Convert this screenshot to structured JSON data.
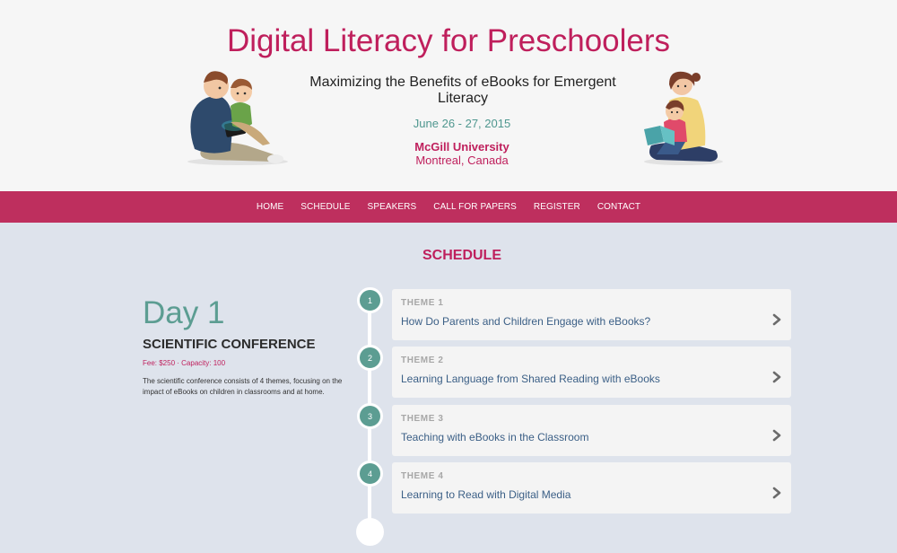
{
  "header": {
    "title": "Digital Literacy for Preschoolers",
    "subtitle": "Maximizing the Benefits of eBooks for Emergent Literacy",
    "dates": "June 26 - 27, 2015",
    "venue_name": "McGill University",
    "venue_location": "Montreal, Canada"
  },
  "nav": {
    "items": [
      {
        "label": "HOME"
      },
      {
        "label": "SCHEDULE"
      },
      {
        "label": "SPEAKERS"
      },
      {
        "label": "CALL FOR PAPERS"
      },
      {
        "label": "REGISTER"
      },
      {
        "label": "CONTACT"
      }
    ]
  },
  "schedule": {
    "title": "SCHEDULE",
    "day": "Day 1",
    "conference_title": "SCIENTIFIC CONFERENCE",
    "fee": "Fee: $250 · Capacity: 100",
    "description": "The scientific conference consists of 4 themes, focusing on the impact of eBooks on children in classrooms and at home.",
    "themes": [
      {
        "number": "1",
        "label": "THEME 1",
        "title": "How Do Parents and Children Engage with eBooks?"
      },
      {
        "number": "2",
        "label": "THEME 2",
        "title": "Learning Language from Shared Reading with eBooks"
      },
      {
        "number": "3",
        "label": "THEME 3",
        "title": "Teaching with eBooks in the Classroom"
      },
      {
        "number": "4",
        "label": "THEME 4",
        "title": "Learning to Read with Digital Media"
      }
    ]
  },
  "colors": {
    "brand": "#bf1f5c",
    "nav_bg": "#be2f5e",
    "accent_teal": "#5c9d92",
    "link_blue": "#3b5f86"
  },
  "icons": {
    "left_illustration": "father-child-tablet-illustration",
    "right_illustration": "mother-child-book-illustration",
    "chevron": "chevron-right-icon"
  }
}
